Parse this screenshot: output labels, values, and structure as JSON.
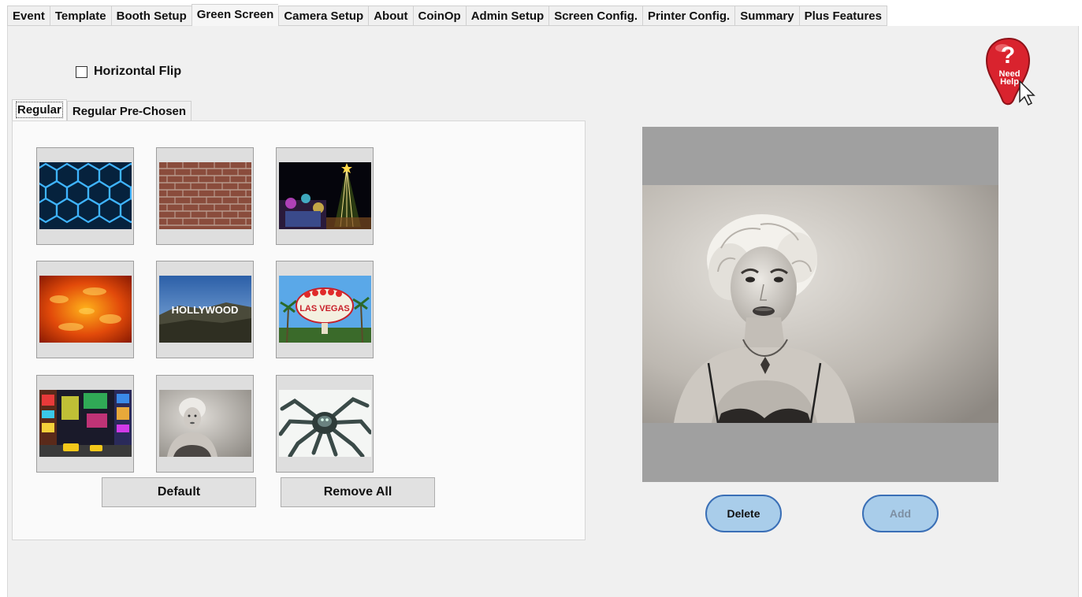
{
  "tabs": [
    "Event",
    "Template",
    "Booth Setup",
    "Green Screen",
    "Camera Setup",
    "About",
    "CoinOp",
    "Admin Setup",
    "Screen Config.",
    "Printer Config.",
    "Summary",
    "Plus Features"
  ],
  "active_tab": "Green Screen",
  "horizontal_flip": {
    "label": "Horizontal Flip",
    "checked": false
  },
  "sub_tabs": [
    "Regular",
    "Regular Pre-Chosen"
  ],
  "backgrounds": [
    {
      "name": "blue-hexagons-image"
    },
    {
      "name": "brick-wall-image"
    },
    {
      "name": "night-christmas-tree-image"
    },
    {
      "name": "fire-image"
    },
    {
      "name": "hollywood-sign-image",
      "text": "HOLLYWOOD"
    },
    {
      "name": "las-vegas-sign-image",
      "text": "LAS VEGAS"
    },
    {
      "name": "times-square-image"
    },
    {
      "name": "marilyn-portrait-image"
    },
    {
      "name": "spider-image"
    }
  ],
  "buttons": {
    "default": "Default",
    "remove_all": "Remove All",
    "delete": "Delete",
    "add": "Add"
  },
  "help": {
    "line1": "Need",
    "line2": "Help"
  },
  "colors": {
    "help_red": "#d9232e",
    "pill_fill": "#a9cdea",
    "pill_border": "#3a6fb6",
    "add_disabled_text": "#7d8fa3"
  }
}
